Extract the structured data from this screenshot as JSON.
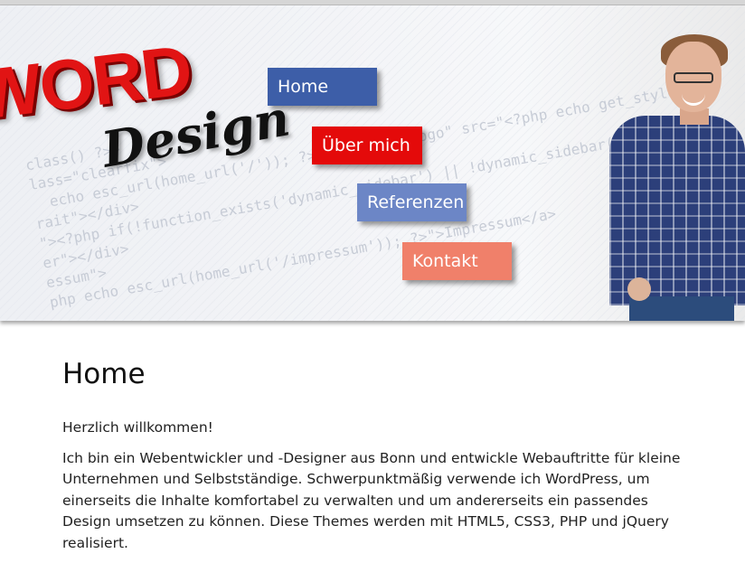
{
  "header": {
    "logo_word": "WORD",
    "logo_design": "Design",
    "code_lines": [
      "class() ?>>",
      "lass=\"clearfix\">",
      "  echo esc_url(home_url('/')); ?>\"><img id=\"logo\" src=\"<?php echo get_style",
      "rait\"></div>",
      "\"><?php if(!function_exists('dynamic_sidebar') || !dynamic_sidebar('Menu'))",
      "er\"></div>",
      "essum\">",
      "php echo esc_url(home_url('/impressum')); ?>\">Impressum</a>"
    ]
  },
  "nav": {
    "home": "Home",
    "about": "Über mich",
    "references": "Referenzen",
    "contact": "Kontakt"
  },
  "main": {
    "title": "Home",
    "greeting": "Herzlich willkommen!",
    "intro": "Ich bin ein Webentwickler und -Designer aus Bonn und entwickle Webauftritte für kleine Unternehmen und Selbstständige. Schwerpunktmäßig verwende ich WordPress, um einerseits die Inhalte komfortabel zu verwalten und um andererseits ein passendes Design umsetzen zu können. Diese Themes werden mit HTML5, CSS3, PHP und jQuery realisiert."
  }
}
